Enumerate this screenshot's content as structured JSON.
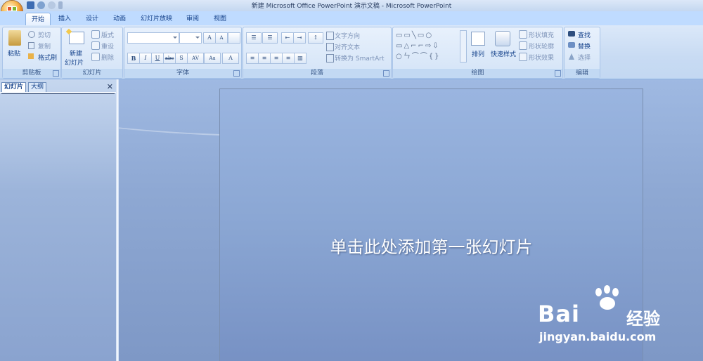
{
  "window": {
    "title": "新建 Microsoft Office PowerPoint 演示文稿 - Microsoft PowerPoint"
  },
  "tabs": [
    "开始",
    "插入",
    "设计",
    "动画",
    "幻灯片放映",
    "审阅",
    "视图"
  ],
  "ribbon": {
    "clipboard": {
      "label": "剪贴板",
      "paste": "粘贴",
      "cut": "剪切",
      "copy": "复制",
      "format_painter": "格式刷"
    },
    "slides": {
      "label": "幻灯片",
      "new_slide_line1": "新建",
      "new_slide_line2": "幻灯片",
      "layout": "版式",
      "reset": "重设",
      "delete": "删除"
    },
    "font": {
      "label": "字体",
      "bold": "B",
      "italic": "I",
      "underline": "U",
      "strike": "abc",
      "shadow": "S",
      "spacing": "AV",
      "case": "Aa",
      "color": "A",
      "grow": "A",
      "shrink": "A"
    },
    "paragraph": {
      "label": "段落",
      "text_direction": "文字方向",
      "align_text": "对齐文本",
      "smartart": "转换为 SmartArt"
    },
    "drawing": {
      "label": "绘图",
      "arrange": "排列",
      "quick_styles": "快速样式",
      "shape_fill": "形状填充",
      "shape_outline": "形状轮廓",
      "shape_effects": "形状效果"
    },
    "editing": {
      "label": "编辑",
      "find": "查找",
      "replace": "替换",
      "select": "选择"
    }
  },
  "left_pane": {
    "tab_slides": "幻灯片",
    "tab_outline": "大纲",
    "close": "✕"
  },
  "slide": {
    "title_placeholder": "单击此处添加第一张幻灯片"
  },
  "watermark": {
    "brand": "Bai",
    "brand_cn": "经验",
    "url": "jingyan.baidu.com"
  },
  "colors": {
    "ribbon_bg": "#c8dbf3",
    "work_bg": "#8ea8d3",
    "text": "#15428b"
  }
}
